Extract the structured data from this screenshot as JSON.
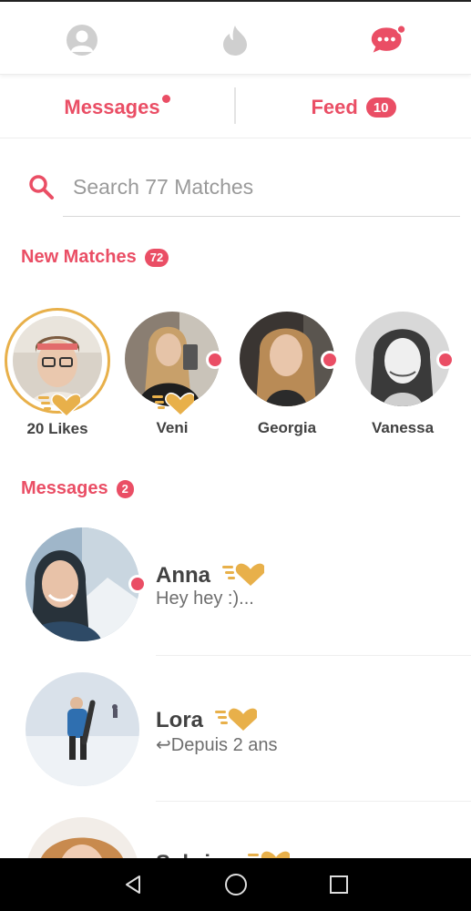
{
  "topbar": {
    "icons": [
      "profile-icon",
      "flame-icon",
      "chat-bubble-icon"
    ],
    "accent": "#ea4e65",
    "inactive": "#cfcfcf"
  },
  "subtabs": {
    "messages_label": "Messages",
    "feed_label": "Feed",
    "feed_count": "10"
  },
  "search": {
    "placeholder": "Search 77 Matches"
  },
  "new_matches": {
    "title": "New Matches",
    "count": "72",
    "items": [
      {
        "name": "20 Likes"
      },
      {
        "name": "Veni"
      },
      {
        "name": "Georgia"
      },
      {
        "name": "Vanessa"
      }
    ]
  },
  "messages": {
    "title": "Messages",
    "count": "2",
    "items": [
      {
        "name": "Anna",
        "preview": "Hey hey :)..."
      },
      {
        "name": "Lora",
        "preview": "↩Depuis 2 ans"
      },
      {
        "name": "Sabrina",
        "preview": ""
      }
    ]
  },
  "colors": {
    "accent": "#ea4e65",
    "gold": "#e8b04a",
    "text": "#424242",
    "muted": "#6e6e6e"
  }
}
